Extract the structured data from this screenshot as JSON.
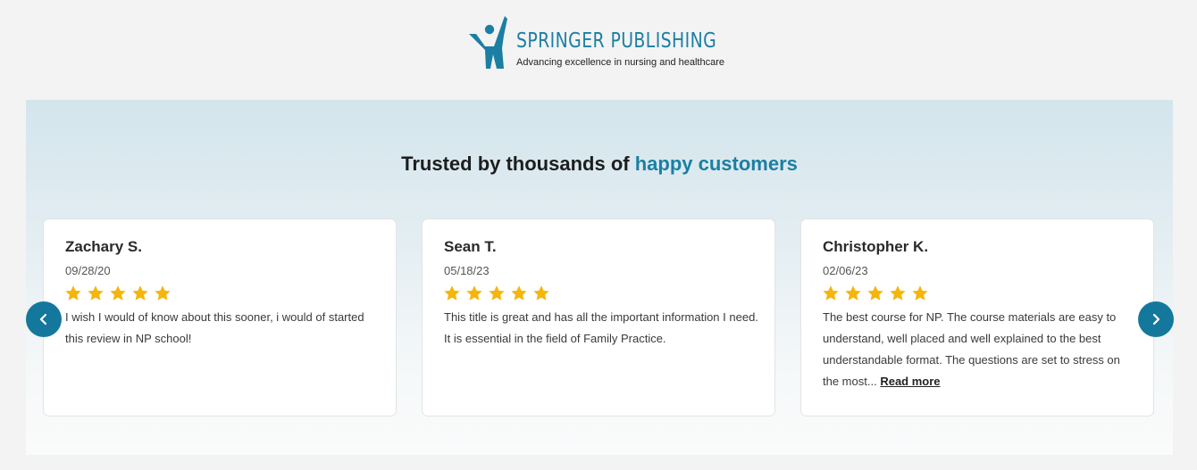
{
  "header": {
    "brand_name": "SPRINGER PUBLISHING",
    "tagline": "Advancing excellence in nursing and healthcare"
  },
  "section": {
    "heading_prefix": "Trusted by thousands of ",
    "heading_accent": "happy customers"
  },
  "colors": {
    "brand": "#1b7fa3",
    "nav_button": "#14789d",
    "star": "#f5b50a"
  },
  "carousel": {
    "prev_icon": "chevron-left-icon",
    "next_icon": "chevron-right-icon"
  },
  "reviews": [
    {
      "name": "Zachary S.",
      "date": "09/28/20",
      "rating": 5,
      "text": "I wish I would of know about this sooner, i would of started this review in NP school!"
    },
    {
      "name": "Sean T.",
      "date": "05/18/23",
      "rating": 5,
      "text": "This title is great and has all the important information I need. It is essential in the field of Family Practice."
    },
    {
      "name": "Christopher K.",
      "date": "02/06/23",
      "rating": 5,
      "text": "The best course for NP. The course materials are easy to understand, well placed and well explained to the best understandable format. The questions are set to stress on the most...",
      "read_more": "Read more"
    }
  ]
}
